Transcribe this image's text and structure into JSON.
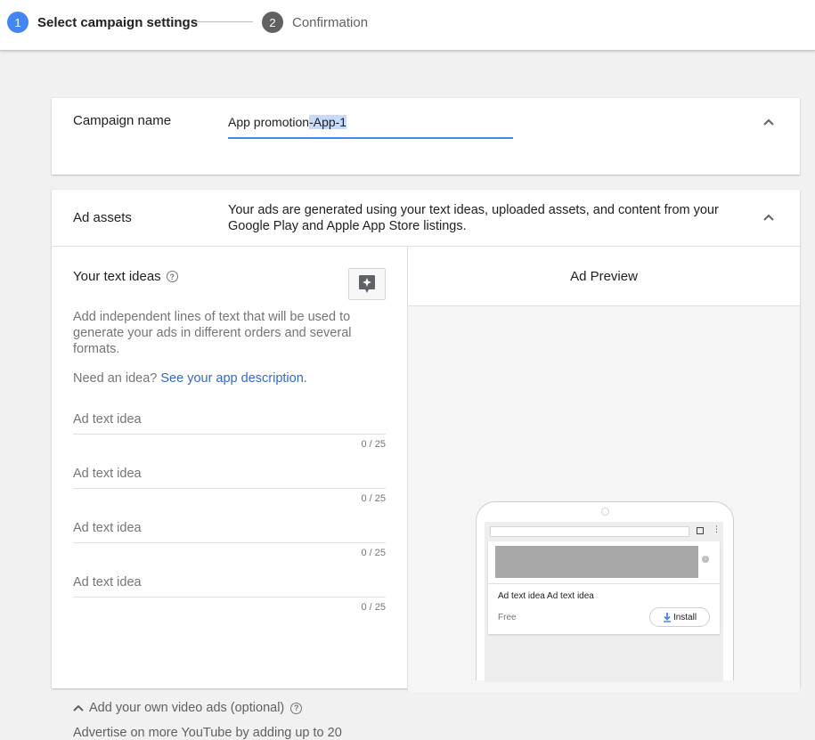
{
  "stepper": {
    "step1": {
      "number": "1",
      "label": "Select campaign settings"
    },
    "step2": {
      "number": "2",
      "label": "Confirmation"
    }
  },
  "campaign_name": {
    "label": "Campaign name",
    "value_plain": "App promotion",
    "value_selected": "-App-1"
  },
  "ad_assets": {
    "label": "Ad assets",
    "description": "Your ads are generated using your text ideas, uploaded assets, and content from your Google Play and Apple App Store listings."
  },
  "text_ideas": {
    "title": "Your text ideas",
    "help_glyph": "?",
    "description": "Add independent lines of text that will be used to generate your ads in different orders and several formats.",
    "idea_prompt": "Need an idea?",
    "idea_link": "See your app description.",
    "fields": [
      {
        "placeholder": "Ad text idea",
        "counter": "0 / 25"
      },
      {
        "placeholder": "Ad text idea",
        "counter": "0 / 25"
      },
      {
        "placeholder": "Ad text idea",
        "counter": "0 / 25"
      },
      {
        "placeholder": "Ad text idea",
        "counter": "0 / 25"
      }
    ],
    "video_toggle": "Add your own video ads (optional)",
    "video_desc_cut": "Advertise on more YouTube by adding up to 20"
  },
  "preview": {
    "title": "Ad Preview",
    "ad_text": "Ad text idea Ad text idea",
    "price": "Free",
    "install_label": "Install",
    "info_glyph": "i"
  },
  "colors": {
    "accent": "#4285f4",
    "link": "#3367d6",
    "selection": "#c6dafc"
  }
}
